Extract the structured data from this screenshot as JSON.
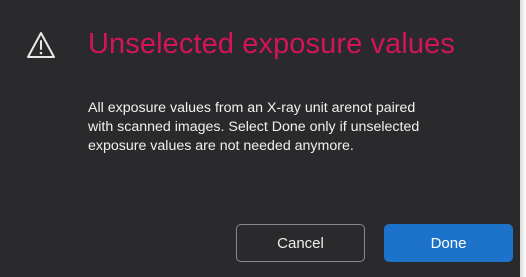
{
  "dialog": {
    "title": "Unselected exposure values",
    "message": "All exposure values from an X-ray unit arenot paired\nwith scanned images. Select Done only if unselected\nexposure values are not needed anymore.",
    "icon": "warning-icon",
    "cancel_label": "Cancel",
    "done_label": "Done"
  },
  "colors": {
    "background": "#2a2a2c",
    "title": "#d4145a",
    "primary_button": "#1d72c9"
  }
}
